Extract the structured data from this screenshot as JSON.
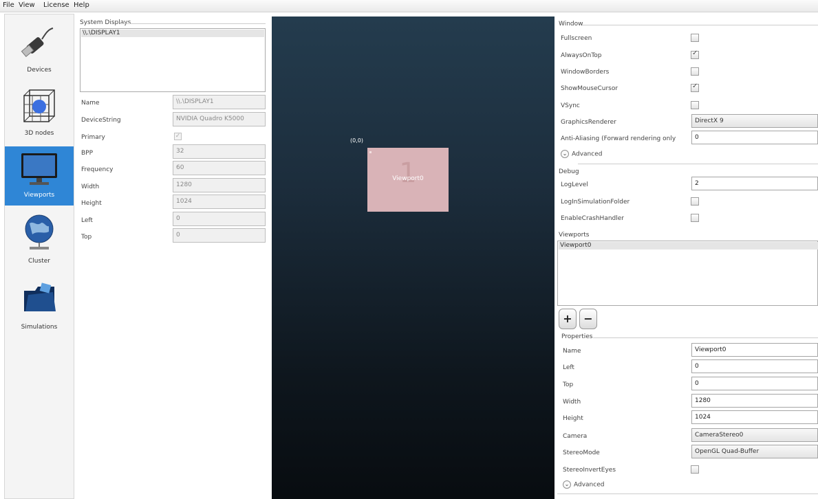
{
  "menu": [
    "File",
    "View",
    "License",
    "Help"
  ],
  "sidebar": {
    "items": [
      {
        "label": "Devices",
        "icon": "usb-plug-icon"
      },
      {
        "label": "3D nodes",
        "icon": "3d-node-cube-icon"
      },
      {
        "label": "Viewports",
        "icon": "monitor-icon",
        "active": true
      },
      {
        "label": "Cluster",
        "icon": "globe-network-icon"
      },
      {
        "label": "Simulations",
        "icon": "folder-icon"
      }
    ]
  },
  "system_displays": {
    "title": "System Displays",
    "list": [
      "\\\\.\\DISPLAY1"
    ],
    "props": [
      {
        "label": "Name",
        "value": "\\\\.\\DISPLAY1",
        "type": "text"
      },
      {
        "label": "DeviceString",
        "value": "NVIDIA Quadro K5000",
        "type": "text"
      },
      {
        "label": "Primary",
        "value": "✓",
        "type": "check"
      },
      {
        "label": "BPP",
        "value": "32",
        "type": "text"
      },
      {
        "label": "Frequency",
        "value": "60",
        "type": "text"
      },
      {
        "label": "Width",
        "value": "1280",
        "type": "text"
      },
      {
        "label": "Height",
        "value": "1024",
        "type": "text"
      },
      {
        "label": "Left",
        "value": "0",
        "type": "text"
      },
      {
        "label": "Top",
        "value": "0",
        "type": "text"
      }
    ]
  },
  "canvas": {
    "origin": "(0,0)",
    "viewport_number": "1",
    "viewport_name": "Viewport0"
  },
  "window": {
    "title": "Window",
    "fullscreen": {
      "label": "Fullscreen",
      "checked": false
    },
    "always_on_top": {
      "label": "AlwaysOnTop",
      "checked": true
    },
    "window_borders": {
      "label": "WindowBorders",
      "checked": false
    },
    "show_mouse_cursor": {
      "label": "ShowMouseCursor",
      "checked": true
    },
    "vsync": {
      "label": "VSync",
      "checked": false
    },
    "graphics_renderer": {
      "label": "GraphicsRenderer",
      "value": "DirectX 9"
    },
    "anti_aliasing": {
      "label": "Anti-Aliasing (Forward rendering only",
      "value": "0"
    },
    "advanced": "Advanced"
  },
  "debug": {
    "title": "Debug",
    "log_level": {
      "label": "LogLevel",
      "value": "2"
    },
    "log_in_sim_folder": {
      "label": "LogInSimulationFolder",
      "checked": false
    },
    "enable_crash_handler": {
      "label": "EnableCrashHandler",
      "checked": false
    }
  },
  "viewports": {
    "title": "Viewports",
    "list": [
      "Viewport0"
    ],
    "add": "+",
    "remove": "−"
  },
  "properties": {
    "title": "Properties",
    "name": {
      "label": "Name",
      "value": "Viewport0"
    },
    "left": {
      "label": "Left",
      "value": "0"
    },
    "top": {
      "label": "Top",
      "value": "0"
    },
    "width": {
      "label": "Width",
      "value": "1280"
    },
    "height": {
      "label": "Height",
      "value": "1024"
    },
    "camera": {
      "label": "Camera",
      "value": "CameraStereo0"
    },
    "stereo_mode": {
      "label": "StereoMode",
      "value": "OpenGL Quad-Buffer"
    },
    "stereo_invert_eyes": {
      "label": "StereoInvertEyes",
      "checked": false
    },
    "advanced": "Advanced"
  },
  "colors": {
    "accent": "#2f86d6",
    "viewport": "#d9b3b7",
    "canvas_top": "#243c4e",
    "canvas_bottom": "#080c10"
  }
}
